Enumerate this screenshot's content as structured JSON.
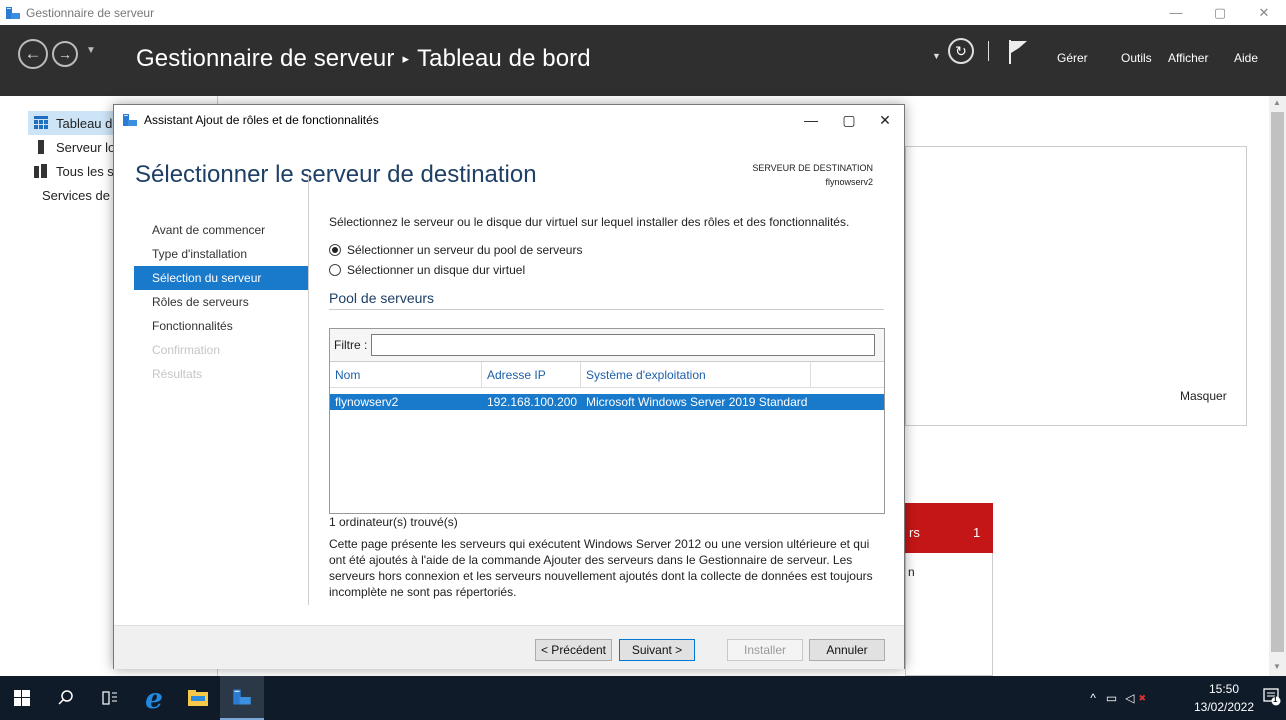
{
  "window": {
    "title": "Gestionnaire de serveur",
    "minimize": "—",
    "maximize": "▢",
    "close": "✕"
  },
  "header": {
    "breadcrumb_root": "Gestionnaire de serveur",
    "breadcrumb_sep": "▸",
    "breadcrumb_page": "Tableau de bord",
    "menu": [
      "Gérer",
      "Outils",
      "Afficher",
      "Aide"
    ]
  },
  "sidebar": {
    "items": [
      {
        "label": "Tableau de bord"
      },
      {
        "label": "Serveur local"
      },
      {
        "label": "Tous les serveurs"
      },
      {
        "label": "Services de fichiers et de stockage"
      }
    ]
  },
  "background": {
    "masquer": "Masquer",
    "tile_text": "rs",
    "tile_count": "1",
    "tile_sub": "n"
  },
  "wizard": {
    "title": "Assistant Ajout de rôles et de fonctionnalités",
    "heading": "Sélectionner le serveur de destination",
    "dest_label": "SERVEUR DE DESTINATION",
    "dest_server": "flynowserv2",
    "steps": [
      {
        "label": "Avant de commencer",
        "state": "normal"
      },
      {
        "label": "Type d'installation",
        "state": "normal"
      },
      {
        "label": "Sélection du serveur",
        "state": "active"
      },
      {
        "label": "Rôles de serveurs",
        "state": "normal"
      },
      {
        "label": "Fonctionnalités",
        "state": "normal"
      },
      {
        "label": "Confirmation",
        "state": "disabled"
      },
      {
        "label": "Résultats",
        "state": "disabled"
      }
    ],
    "intro": "Sélectionnez le serveur ou le disque dur virtuel sur lequel installer des rôles et des fonctionnalités.",
    "radio_pool": "Sélectionner un serveur du pool de serveurs",
    "radio_vhd": "Sélectionner un disque dur virtuel",
    "pool_title": "Pool de serveurs",
    "filter_label": "Filtre :",
    "filter_value": "",
    "columns": [
      "Nom",
      "Adresse IP",
      "Système d'exploitation"
    ],
    "rows": [
      {
        "name": "flynowserv2",
        "ip": "192.168.100.200",
        "os": "Microsoft Windows Server 2019 Standard"
      }
    ],
    "found": "1 ordinateur(s) trouvé(s)",
    "description": "Cette page présente les serveurs qui exécutent Windows Server 2012 ou une version ultérieure et qui ont été ajoutés à l'aide de la commande Ajouter des serveurs dans le Gestionnaire de serveur. Les serveurs hors connexion et les serveurs nouvellement ajoutés dont la collecte de données est toujours incomplète ne sont pas répertoriés.",
    "buttons": {
      "previous": "< Précédent",
      "next": "Suivant >",
      "install": "Installer",
      "cancel": "Annuler"
    }
  },
  "taskbar": {
    "time": "15:50",
    "date": "13/02/2022",
    "notif_count": "1"
  },
  "colors": {
    "accent": "#1979ca",
    "header_bg": "#2f2f2f",
    "taskbar_bg": "#101b2a",
    "alert_red": "#c51617"
  }
}
